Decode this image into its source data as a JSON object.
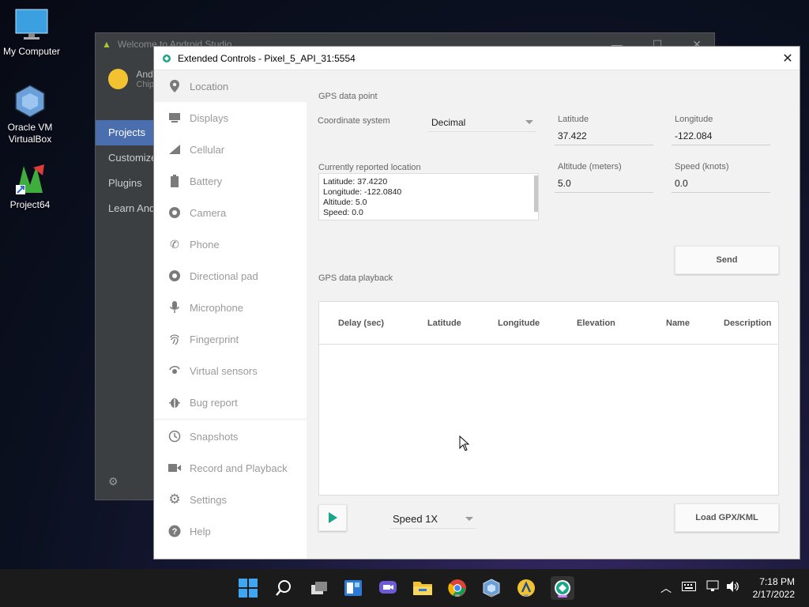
{
  "desktop": {
    "icons": [
      {
        "label": "My Computer"
      },
      {
        "label": "Oracle VM VirtualBox"
      },
      {
        "label": "Project64"
      }
    ]
  },
  "background_window": {
    "title": "Welcome to Android Studio",
    "profile_text": "And",
    "profile_sub": "Chip",
    "nav": [
      "Projects",
      "Customize",
      "Plugins",
      "Learn Andr"
    ]
  },
  "window": {
    "title": "Extended Controls - Pixel_5_API_31:5554",
    "close_glyph": "✕"
  },
  "sidebar": {
    "items": [
      {
        "label": "Location",
        "icon": "location-icon"
      },
      {
        "label": "Displays",
        "icon": "displays-icon"
      },
      {
        "label": "Cellular",
        "icon": "cellular-icon"
      },
      {
        "label": "Battery",
        "icon": "battery-icon"
      },
      {
        "label": "Camera",
        "icon": "camera-icon"
      },
      {
        "label": "Phone",
        "icon": "phone-icon"
      },
      {
        "label": "Directional pad",
        "icon": "dpad-icon"
      },
      {
        "label": "Microphone",
        "icon": "microphone-icon"
      },
      {
        "label": "Fingerprint",
        "icon": "fingerprint-icon"
      },
      {
        "label": "Virtual sensors",
        "icon": "sensors-icon"
      },
      {
        "label": "Bug report",
        "icon": "bug-icon"
      },
      {
        "label": "Snapshots",
        "icon": "snapshots-icon"
      },
      {
        "label": "Record and Playback",
        "icon": "record-icon"
      },
      {
        "label": "Settings",
        "icon": "gear-icon"
      },
      {
        "label": "Help",
        "icon": "help-icon"
      }
    ],
    "active": "Location"
  },
  "gps_point": {
    "section_title": "GPS data point",
    "coordinate_system_label": "Coordinate system",
    "coordinate_system_value": "Decimal",
    "latitude_label": "Latitude",
    "latitude_value": "37.422",
    "longitude_label": "Longitude",
    "longitude_value": "-122.084",
    "altitude_label": "Altitude (meters)",
    "altitude_value": "5.0",
    "speed_label": "Speed (knots)",
    "speed_value": "0.0",
    "reported_label": "Currently reported location",
    "reported_lines": [
      "Latitude: 37.4220",
      "Longitude: -122.0840",
      "Altitude: 5.0",
      "Speed: 0.0"
    ],
    "send_label": "Send"
  },
  "playback": {
    "section_title": "GPS data playback",
    "columns": [
      "Delay (sec)",
      "Latitude",
      "Longitude",
      "Elevation",
      "Name",
      "Description"
    ],
    "speed_value": "Speed 1X",
    "load_label": "Load GPX/KML"
  },
  "taskbar": {
    "time": "7:18 PM",
    "date": "2/17/2022"
  },
  "colors": {
    "accent_teal": "#1aa589",
    "active_nav": "#4b6eaf"
  }
}
